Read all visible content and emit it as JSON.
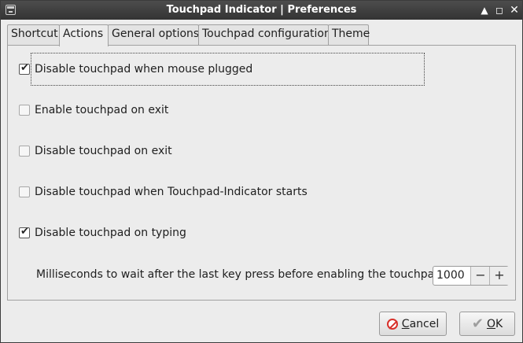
{
  "window": {
    "title": "Touchpad Indicator | Preferences"
  },
  "titlebar_buttons": {
    "up": "▲",
    "maximize": "◻",
    "close": "✕"
  },
  "tabs": [
    {
      "label": "Shortcut",
      "active": false
    },
    {
      "label": "Actions",
      "active": true
    },
    {
      "label": "General options",
      "active": false
    },
    {
      "label": "Touchpad configuration",
      "active": false
    },
    {
      "label": "Theme",
      "active": false
    }
  ],
  "options": [
    {
      "label": "Disable touchpad when mouse plugged",
      "checked": true
    },
    {
      "label": "Enable touchpad on exit",
      "checked": false
    },
    {
      "label": "Disable touchpad on exit",
      "checked": false
    },
    {
      "label": "Disable touchpad when Touchpad-Indicator starts",
      "checked": false
    },
    {
      "label": "Disable touchpad on typing",
      "checked": true
    }
  ],
  "milliseconds": {
    "label": "Milliseconds to wait after the last key press before enabling the touchpad:",
    "value": "1000",
    "minus": "−",
    "plus": "+"
  },
  "buttons": {
    "cancel": {
      "mnemonic": "C",
      "rest": "ancel"
    },
    "ok": {
      "mnemonic": "O",
      "rest": "K"
    }
  }
}
